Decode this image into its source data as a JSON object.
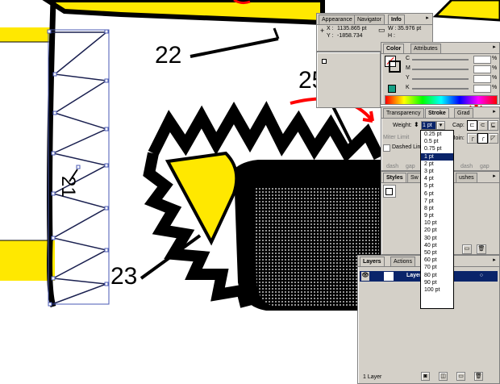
{
  "canvas_labels": {
    "n21": "21",
    "n22": "22",
    "n23": "23",
    "n25": "25"
  },
  "info_panel": {
    "tabs": [
      "Appearance",
      "Navigator",
      "Info"
    ],
    "x_label": "X :",
    "x_value": "1135.865 pt",
    "y_label": "Y :",
    "y_value": "-1858.734",
    "w_label": "W :",
    "w_value": "35.976 pt",
    "h_label": "H :"
  },
  "color_panel": {
    "tabs": [
      "Color",
      "Attributes"
    ],
    "channels": [
      "C",
      "M",
      "Y",
      "K"
    ],
    "pct_symbol": "%"
  },
  "stroke_panel": {
    "tabs": [
      "Transparency",
      "Stroke",
      "Grad"
    ],
    "weight_label": "Weight:",
    "weight_value": "1 pt",
    "cap_label": "Cap:",
    "join_label": "Join:",
    "miter_label": "Miter Limit",
    "dashed_label": "Dashed Line",
    "dash_labels": [
      "dash",
      "gap",
      "dash",
      "gap",
      "dash",
      "gap"
    ]
  },
  "weight_menu": {
    "options": [
      "0.25 pt",
      "0.5 pt",
      "0.75 pt",
      "1 pt",
      "2 pt",
      "3 pt",
      "4 pt",
      "5 pt",
      "6 pt",
      "7 pt",
      "8 pt",
      "9 pt",
      "10 pt",
      "20 pt",
      "30 pt",
      "40 pt",
      "50 pt",
      "60 pt",
      "70 pt",
      "80 pt",
      "90 pt",
      "100 pt"
    ],
    "selected": "1 pt"
  },
  "styles_panel": {
    "tabs": [
      "Styles",
      "Sw",
      "ushes"
    ]
  },
  "layers_panel": {
    "tabs": [
      "Layers",
      "Actions"
    ],
    "layer_name": "Layer",
    "footer": "1 Layer"
  },
  "colors": {
    "yellow": "#ffe800",
    "panel": "#d4d0c8",
    "highlight": "#0a246a",
    "annotation": "#ff0000",
    "selection": "#4a5ab4"
  }
}
